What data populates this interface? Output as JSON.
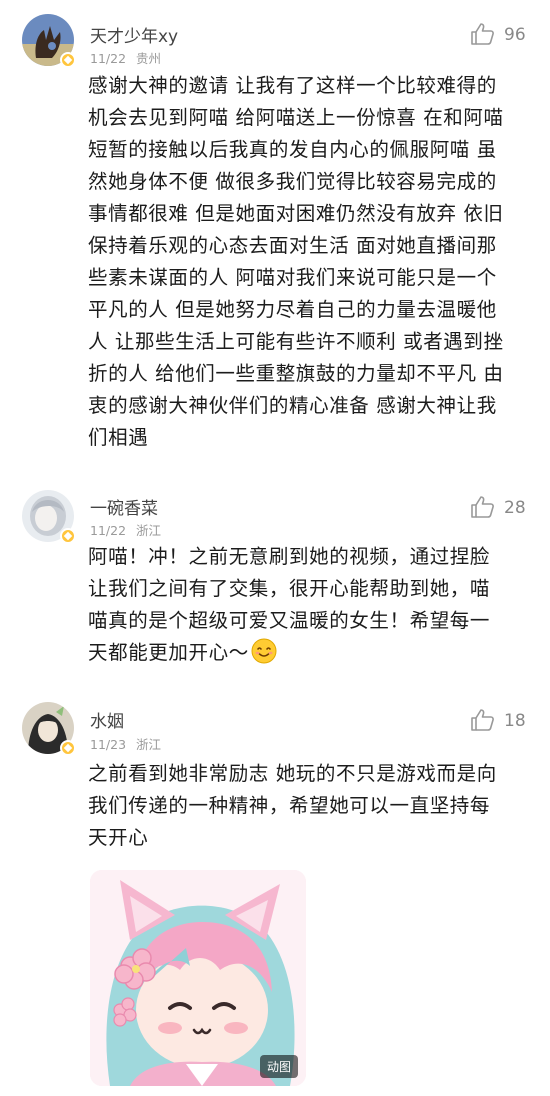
{
  "comments": [
    {
      "username": "天才少年xy",
      "date": "11/22",
      "location": "贵州",
      "likes": "96",
      "text": "感谢大神的邀请 让我有了这样一个比较难得的\n机会去见到阿喵 给阿喵送上一份惊喜 在和阿喵\n短暂的接触以后我真的发自内心的佩服阿喵 虽\n然她身体不便 做很多我们觉得比较容易完成的\n事情都很难 但是她面对困难仍然没有放弃 依旧\n保持着乐观的心态去面对生活 面对她直播间那\n些素未谋面的人 阿喵对我们来说可能只是一个\n平凡的人 但是她努力尽着自己的力量去温暖他\n人 让那些生活上可能有些许不顺利 或者遇到挫\n折的人 给他们一些重整旗鼓的力量却不平凡 由\n衷的感谢大神伙伴们的精心准备 感谢大神让我\n们相遇"
    },
    {
      "username": "一碗香菜",
      "date": "11/22",
      "location": "浙江",
      "likes": "28",
      "text": "阿喵！冲！之前无意刷到她的视频，通过捏脸\n让我们之间有了交集，很开心能帮助到她，喵\n喵真的是个超级可爱又温暖的女生！希望每一\n天都能更加开心～"
    },
    {
      "username": "水姻",
      "date": "11/23",
      "location": "浙江",
      "likes": "18",
      "text": "之前看到她非常励志  她玩的不只是游戏而是向\n我们传递的一种精神，希望她可以一直坚持每\n天开心",
      "sticker_tag": "动图"
    }
  ],
  "icons": {
    "like": "thumbs-up-icon",
    "badge": "verified-badge-icon",
    "emoji": "smiling-face-emoji"
  },
  "colors": {
    "username": "#444444",
    "meta": "#9a9a9a",
    "badge": "#ffc53d",
    "text": "#1c1c1c"
  }
}
